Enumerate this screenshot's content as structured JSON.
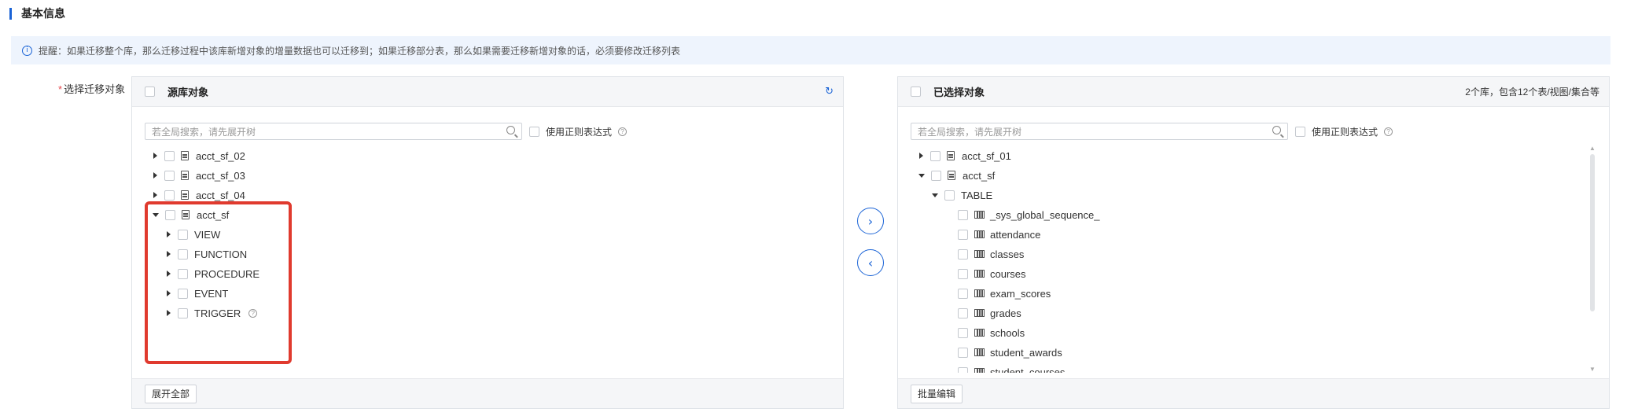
{
  "section": {
    "title": "基本信息"
  },
  "notice": {
    "text": "提醒：如果迁移整个库，那么迁移过程中该库新增对象的增量数据也可以迁移到；如果迁移部分表，那么如果需要迁移新增对象的话，必须要修改迁移列表"
  },
  "field": {
    "label": "选择迁移对象",
    "required_mark": "*"
  },
  "left_panel": {
    "title": "源库对象",
    "search_placeholder": "若全局搜索，请先展开树",
    "regex_label": "使用正则表达式",
    "tree": [
      {
        "label": "acct_sf_02",
        "type": "database",
        "expanded": false,
        "level": 0
      },
      {
        "label": "acct_sf_03",
        "type": "database",
        "expanded": false,
        "level": 0
      },
      {
        "label": "acct_sf_04",
        "type": "database",
        "expanded": false,
        "level": 0
      },
      {
        "label": "acct_sf",
        "type": "database",
        "expanded": true,
        "level": 0
      },
      {
        "label": "VIEW",
        "type": "group",
        "expanded": false,
        "level": 1
      },
      {
        "label": "FUNCTION",
        "type": "group",
        "expanded": false,
        "level": 1
      },
      {
        "label": "PROCEDURE",
        "type": "group",
        "expanded": false,
        "level": 1
      },
      {
        "label": "EVENT",
        "type": "group",
        "expanded": false,
        "level": 1
      },
      {
        "label": "TRIGGER",
        "type": "group",
        "expanded": false,
        "level": 1
      }
    ],
    "footer_button": "展开全部"
  },
  "right_panel": {
    "title": "已选择对象",
    "summary": "2个库，包含12个表/视图/集合等",
    "search_placeholder": "若全局搜索，请先展开树",
    "regex_label": "使用正则表达式",
    "tree": [
      {
        "label": "acct_sf_01",
        "type": "database",
        "expanded": false,
        "level": 0
      },
      {
        "label": "acct_sf",
        "type": "database",
        "expanded": true,
        "level": 0
      },
      {
        "label": "TABLE",
        "type": "group",
        "expanded": true,
        "level": 1
      },
      {
        "label": "_sys_global_sequence_",
        "type": "table",
        "level": 2
      },
      {
        "label": "attendance",
        "type": "table",
        "level": 2
      },
      {
        "label": "classes",
        "type": "table",
        "level": 2
      },
      {
        "label": "courses",
        "type": "table",
        "level": 2
      },
      {
        "label": "exam_scores",
        "type": "table",
        "level": 2
      },
      {
        "label": "grades",
        "type": "table",
        "level": 2
      },
      {
        "label": "schools",
        "type": "table",
        "level": 2
      },
      {
        "label": "student_awards",
        "type": "table",
        "level": 2
      },
      {
        "label": "student_courses",
        "type": "table",
        "level": 2
      }
    ],
    "footer_button": "批量编辑"
  },
  "transfer": {
    "add_icon": "chevron-right-icon",
    "remove_icon": "chevron-left-icon"
  },
  "colors": {
    "accent": "#1a63d6",
    "highlight": "#e03a2e",
    "notice_bg": "#eef4fd"
  }
}
